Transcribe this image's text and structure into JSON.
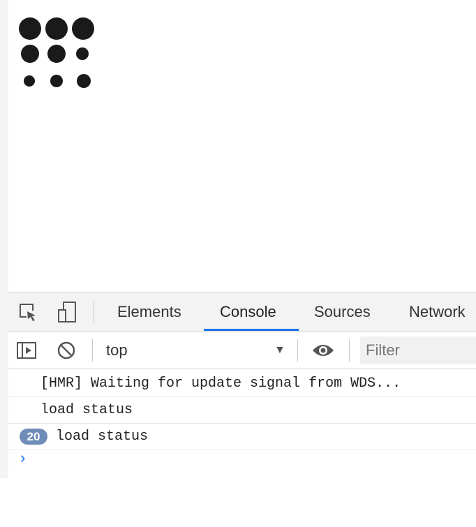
{
  "devtools": {
    "tabs": [
      {
        "label": "Elements",
        "active": false
      },
      {
        "label": "Console",
        "active": true
      },
      {
        "label": "Sources",
        "active": false
      },
      {
        "label": "Network",
        "active": false
      }
    ],
    "toolbar": {
      "context": "top",
      "filter_placeholder": "Filter"
    },
    "console": {
      "messages": [
        {
          "text": "[HMR] Waiting for update signal from WDS..."
        },
        {
          "text": "load status"
        },
        {
          "text": "load status",
          "repeat_count": "20"
        }
      ],
      "prompt": "›"
    },
    "icons": [
      "inspect-element-icon",
      "device-toolbar-icon",
      "sidebar-toggle-icon",
      "clear-console-icon",
      "live-expression-eye-icon"
    ],
    "accent_color": "#1a73e8"
  }
}
